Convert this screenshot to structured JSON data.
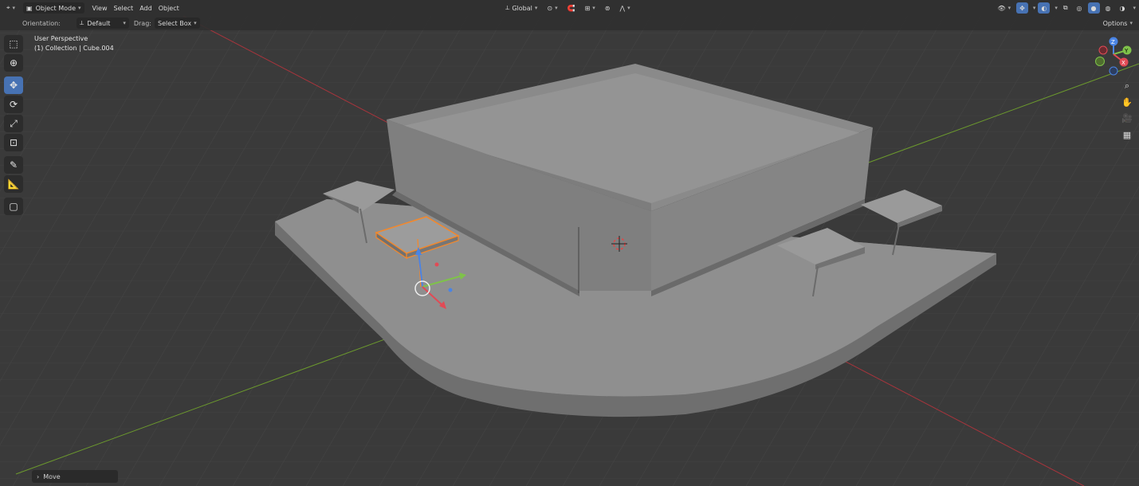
{
  "header": {
    "editor_type_icon": "view3d-icon",
    "mode": "Object Mode",
    "menus": [
      "View",
      "Select",
      "Add",
      "Object"
    ],
    "transform_orientation": "Global",
    "options_label": "Options"
  },
  "tool_settings": {
    "orientation_label": "Orientation:",
    "orientation_value": "Default",
    "drag_label": "Drag:",
    "drag_value": "Select Box"
  },
  "viewport": {
    "view_name": "User Perspective",
    "collection_info": "(1) Collection | Cube.004"
  },
  "toolbar": {
    "tools": [
      {
        "icon": "select-box-icon",
        "active": false
      },
      {
        "icon": "cursor-icon",
        "active": false
      },
      {
        "icon": "move-icon",
        "active": true
      },
      {
        "icon": "rotate-icon",
        "active": false
      },
      {
        "icon": "scale-icon",
        "active": false
      },
      {
        "icon": "transform-icon",
        "active": false
      },
      {
        "icon": "annotate-icon",
        "active": false
      },
      {
        "icon": "measure-icon",
        "active": false
      },
      {
        "icon": "add-cube-icon",
        "active": false
      }
    ]
  },
  "gizmo": {
    "x_label": "X",
    "y_label": "Y",
    "z_label": "Z"
  },
  "operator_panel": {
    "label": "Move"
  },
  "colors": {
    "grid_bg": "#3a3a3a",
    "x_axis": "#a8343c",
    "y_axis": "#6c9a2d",
    "selection": "#f5882a",
    "active_tool": "#4772b3"
  }
}
